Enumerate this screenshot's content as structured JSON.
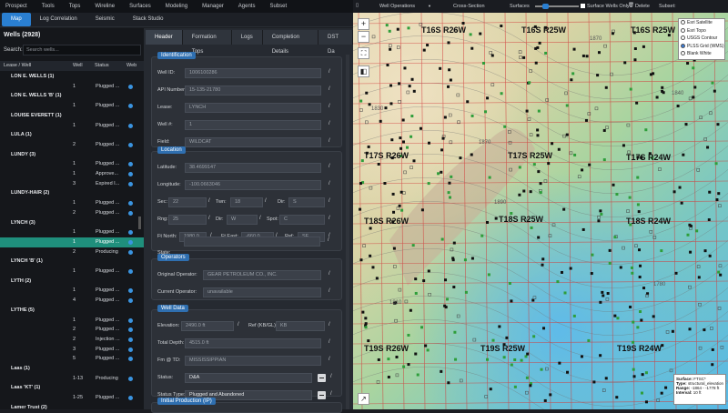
{
  "menu": [
    "Prospect",
    "Tools",
    "Tops",
    "Wireline",
    "Surfaces",
    "Modeling",
    "Manager",
    "Agents",
    "Subset"
  ],
  "tabs": [
    "Map",
    "Log Correlation",
    "Seismic",
    "Stack Studio"
  ],
  "wells_title": "Wells (2928)",
  "search": {
    "label": "Search:",
    "placeholder": "Search wells..."
  },
  "columns": [
    "Lease / Well",
    "Well",
    "Status",
    "Web"
  ],
  "rows": [
    {
      "type": "group",
      "name": "LON E. WELLS (1)"
    },
    {
      "type": "row",
      "well": "1",
      "status": "Plugged ...",
      "web": true
    },
    {
      "type": "group",
      "name": "LON E. WELLS 'B' (1)"
    },
    {
      "type": "row",
      "well": "1",
      "status": "Plugged ...",
      "web": true
    },
    {
      "type": "group",
      "name": "LOUISE EVERETT (1)"
    },
    {
      "type": "row",
      "well": "1",
      "status": "Plugged ...",
      "web": true
    },
    {
      "type": "group",
      "name": "LULA (1)"
    },
    {
      "type": "row",
      "well": "2",
      "status": "Plugged ...",
      "web": true
    },
    {
      "type": "group",
      "name": "LUNDY (3)"
    },
    {
      "type": "row",
      "well": "1",
      "status": "Plugged ...",
      "web": true
    },
    {
      "type": "row",
      "well": "1",
      "status": "Approve...",
      "web": true
    },
    {
      "type": "row",
      "well": "3",
      "status": "Expired I...",
      "web": true
    },
    {
      "type": "group",
      "name": "LUNDY-HAIR (2)"
    },
    {
      "type": "row",
      "well": "1",
      "status": "Plugged ...",
      "web": true
    },
    {
      "type": "row",
      "well": "2",
      "status": "Plugged ...",
      "web": true
    },
    {
      "type": "group",
      "name": "LYNCH (3)"
    },
    {
      "type": "row",
      "well": "1",
      "status": "Plugged ...",
      "web": true
    },
    {
      "type": "row",
      "well": "1",
      "status": "Plugged ...",
      "web": true,
      "selected": true
    },
    {
      "type": "row",
      "well": "2",
      "status": "Producing",
      "web": true
    },
    {
      "type": "group",
      "name": "LYNCH 'B' (1)"
    },
    {
      "type": "row",
      "well": "1",
      "status": "Plugged ...",
      "web": true
    },
    {
      "type": "group",
      "name": "LYTH (2)"
    },
    {
      "type": "row",
      "well": "1",
      "status": "Plugged ...",
      "web": true
    },
    {
      "type": "row",
      "well": "4",
      "status": "Plugged ...",
      "web": true
    },
    {
      "type": "group",
      "name": "LYTHE (5)"
    },
    {
      "type": "row",
      "well": "1",
      "status": "Plugged ...",
      "web": true
    },
    {
      "type": "row",
      "well": "2",
      "status": "Plugged ...",
      "web": true
    },
    {
      "type": "row",
      "well": "2",
      "status": "Injection ...",
      "web": true
    },
    {
      "type": "row",
      "well": "3",
      "status": "Plugged ...",
      "web": true
    },
    {
      "type": "row",
      "well": "5",
      "status": "Plugged ...",
      "web": true
    },
    {
      "type": "group",
      "name": "Laas (1)"
    },
    {
      "type": "row",
      "well": "1-13",
      "status": "Producing",
      "web": true
    },
    {
      "type": "group",
      "name": "Laas 'KT' (1)"
    },
    {
      "type": "row",
      "well": "1-25",
      "status": "Plugged ...",
      "web": true
    },
    {
      "type": "group",
      "name": "Lamer Trust (2)"
    }
  ],
  "detail_tabs": [
    "Header",
    "Formation Tops",
    "Logs",
    "Completion Details",
    "DST Da"
  ],
  "identification": {
    "title": "Identification",
    "well_id_label": "Well ID:",
    "well_id": "1006100286",
    "api_label": "API Number:",
    "api": "15-135-21780",
    "lease_label": "Lease:",
    "lease": "LYNCH",
    "wellno_label": "Well #:",
    "wellno": "1",
    "field_label": "Field:",
    "field": "WILDCAT"
  },
  "location": {
    "title": "Location",
    "lat_label": "Latitude:",
    "lat": "38.4699147",
    "lon_label": "Longitude:",
    "lon": "-100.0663046",
    "sec_label": "Sec:",
    "sec": "22",
    "twn_label": "Twn:",
    "twn": "18",
    "dir1_label": "Dir:",
    "dir1": "S",
    "rng_label": "Rng:",
    "rng": "25",
    "dir2_label": "Dir:",
    "dir2": "W",
    "spot_label": "Spot:",
    "spot": "C",
    "ftn_label": "Ft North:",
    "ftn": "1980.0",
    "fte_label": "Ft East:",
    "fte": "-660.0",
    "ref_label": "Ref:",
    "ref": "SE",
    "state_label": "State:",
    "state": ""
  },
  "operators": {
    "title": "Operators",
    "orig_label": "Original Operator:",
    "orig": "GEAR PETROLEUM CO., INC.",
    "curr_label": "Current Operator:",
    "curr": "unavailable"
  },
  "welldata": {
    "title": "Well Data",
    "elev_label": "Elevation:",
    "elev": "2490.0 ft",
    "refkb_label": "Ref (KB/GL):",
    "refkb": "KB",
    "td_label": "Total Depth:",
    "td": "4515.0 ft",
    "fm_label": "Fm @ TD:",
    "fm": "MISSISSIPPIAN",
    "status_label": "Status:",
    "status": "D&A",
    "statustype_label": "Status Type:",
    "statustype": "Plugged and Abandoned"
  },
  "initprod": {
    "title": "Initial Production (IP)"
  },
  "mapbar": {
    "well_ops": "Well Operations",
    "xsec": "Cross-Section",
    "surfaces": "Surfaces",
    "surface_only": "Surface Wells Only",
    "delete": "Delete",
    "subset": "Subset:"
  },
  "layers": [
    "Esri Satellite",
    "Esri Topo",
    "USGS Contour",
    "PLSS Grid (WMS)",
    "Blank White"
  ],
  "selected_layer": 3,
  "infobox": {
    "surface_label": "Surface:",
    "surface": "FTSC*",
    "type_label": "Type:",
    "type": "structural_elevation",
    "range_label": "Range:",
    "range": "-1864 - -1778 ft",
    "interval_label": "Interval:",
    "interval": "10 ft"
  },
  "township_labels": [
    "T16S R26W",
    "T16S R25W",
    "T16S R25W",
    "T17S R26W",
    "T17S R25W",
    "T17S R24W",
    "T18S R26W",
    "T18S R25W",
    "T18S R24W",
    "T19S R26W",
    "T19S R25W",
    "T19S R24W"
  ],
  "map_numbers": [
    "1830",
    "1870",
    "1870",
    "1840",
    "1810",
    "1890",
    "1780"
  ]
}
